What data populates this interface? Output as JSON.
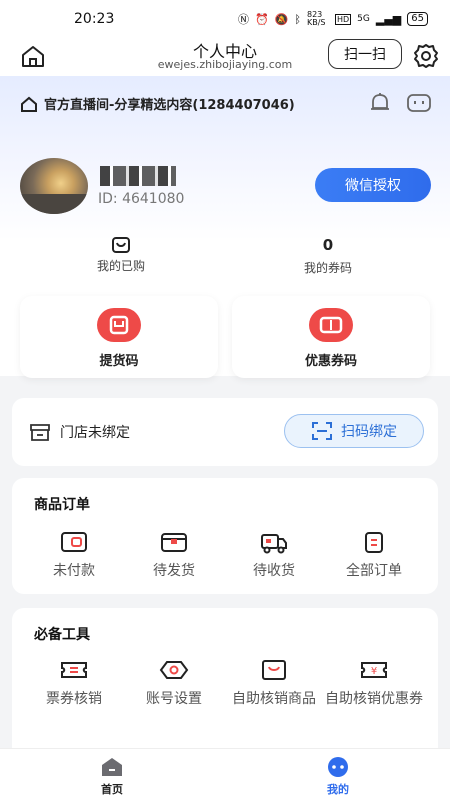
{
  "status_bar": {
    "time": "20:23",
    "network_speed": "823 KB/S",
    "signal": "5G",
    "battery": "65"
  },
  "header": {
    "title": "个人中心",
    "domain": "ewejes.zhibojiaying.com",
    "scan_label": "扫一扫"
  },
  "live_bar": {
    "text": "官方直播间-分享精选内容(1284407046)"
  },
  "user": {
    "id_text": "ID: 4641080",
    "auth_button": "微信授权"
  },
  "stats": [
    {
      "value": "",
      "label": "我的已购"
    },
    {
      "value": "0",
      "label": "我的券码"
    }
  ],
  "code_cards": [
    {
      "label": "提货码",
      "icon": "pickup-code-icon"
    },
    {
      "label": "优惠券码",
      "icon": "coupon-code-icon"
    }
  ],
  "store": {
    "label": "门店未绑定",
    "bind_button": "扫码绑定"
  },
  "orders": {
    "title": "商品订单",
    "items": [
      {
        "label": "未付款",
        "icon": "unpaid-icon"
      },
      {
        "label": "待发货",
        "icon": "to-ship-icon"
      },
      {
        "label": "待收货",
        "icon": "to-receive-icon"
      },
      {
        "label": "全部订单",
        "icon": "all-orders-icon"
      }
    ]
  },
  "tools": {
    "title": "必备工具",
    "items": [
      {
        "label": "票券核销",
        "icon": "ticket-verify-icon"
      },
      {
        "label": "账号设置",
        "icon": "account-settings-icon"
      },
      {
        "label": "自助核销商品",
        "icon": "self-verify-goods-icon"
      },
      {
        "label": "自助核销优惠券",
        "icon": "self-verify-coupon-icon"
      }
    ]
  },
  "tabbar": [
    {
      "label": "首页",
      "icon": "home-tab-icon",
      "active": false
    },
    {
      "label": "我的",
      "icon": "profile-tab-icon",
      "active": true
    }
  ],
  "colors": {
    "accent": "#2f6cec",
    "red": "#ee4a48",
    "active_tab": "#2f6cec"
  }
}
